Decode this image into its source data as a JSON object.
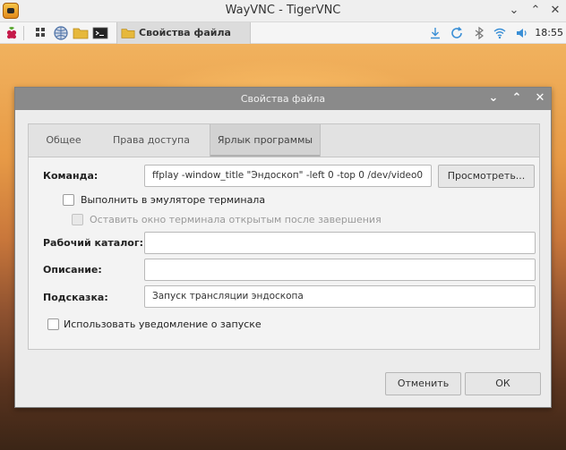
{
  "vnc_window": {
    "title": "WayVNC - TigerVNC"
  },
  "taskbar": {
    "task_label": "Свойства файла",
    "clock": "18:55"
  },
  "dialog": {
    "title": "Свойства файла",
    "tabs": [
      "Общее",
      "Права доступа",
      "Ярлык программы"
    ],
    "active_tab": "Ярлык программы",
    "command_label": "Команда:",
    "command_value": "ffplay -window_title \"Эндоскоп\" -left 0 -top 0 /dev/video0",
    "browse_label": "Просмотреть...",
    "run_in_terminal_label": "Выполнить в эмуляторе терминала",
    "keep_terminal_open_label": "Оставить окно терминала открытым после завершения",
    "workdir_label": "Рабочий каталог:",
    "workdir_value": "",
    "description_label": "Описание:",
    "description_value": "",
    "tooltip_label": "Подсказка:",
    "tooltip_value": "Запуск трансляции эндоскопа",
    "startup_notify_label": "Использовать уведомление о запуске",
    "cancel_label": "Отменить",
    "ok_label": "ОК"
  }
}
